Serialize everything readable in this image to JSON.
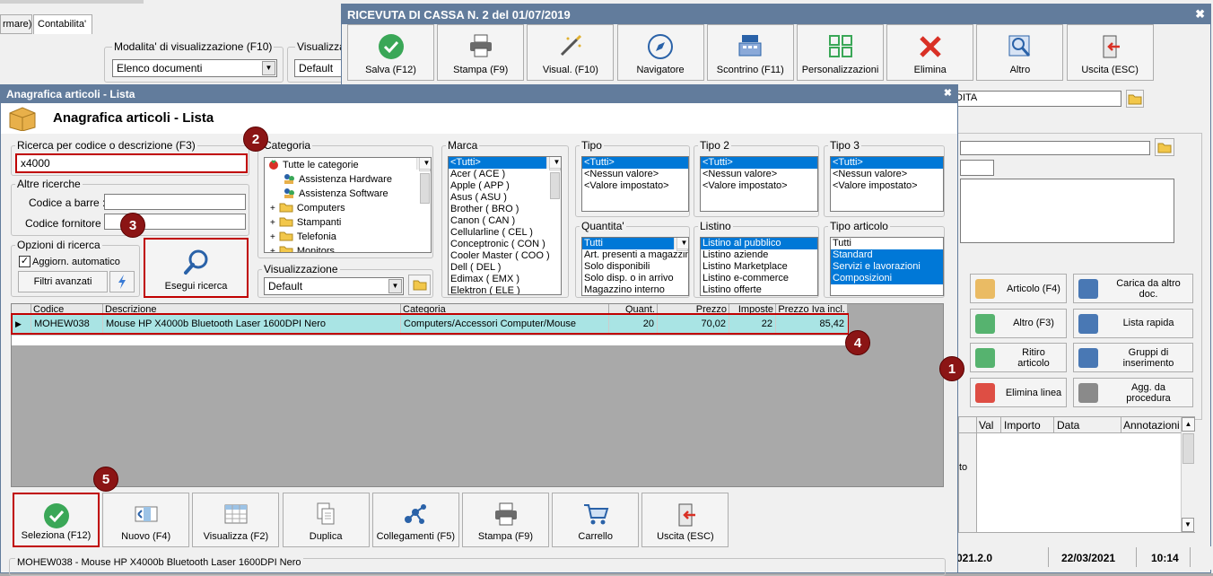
{
  "bg": {
    "tab1": "rmare)",
    "tab2": "Contabilita'",
    "mode_label": "Modalita' di visualizzazione (F10)",
    "mode_value": "Elenco documenti",
    "vis_label": "Visualizza",
    "vis_value": "Default"
  },
  "receipt": {
    "title": "RICEVUTA DI CASSA N. 2 del 01/07/2019",
    "toolbar": [
      "Salva (F12)",
      "Stampa (F9)",
      "Visual. (F10)",
      "Navigatore",
      "Scontrino (F11)",
      "Personalizzazioni",
      "Elimina",
      "Altro",
      "Uscita (ESC)"
    ],
    "field_text": "DITA",
    "side_buttons": [
      [
        "Articolo (F4)",
        "Carica da altro doc."
      ],
      [
        "Altro (F3)",
        "Lista rapida"
      ],
      [
        "Ritiro articolo",
        "Gruppi di inserimento"
      ],
      [
        "Elimina linea",
        "Agg. da procedura"
      ]
    ],
    "grid_headers": [
      "Val",
      "Importo",
      "Data",
      "Annotazioni"
    ],
    "grid_fragment": "to",
    "status": [
      "021.2.0",
      "22/03/2021",
      "10:14"
    ]
  },
  "dialog": {
    "titlebar": "Anagrafica articoli  - Lista",
    "heading": "Anagrafica articoli  - Lista",
    "search_label": "Ricerca per codice o descrizione (F3)",
    "search_value": "x4000",
    "other_label": "Altre ricerche",
    "barcode_label": "Codice a barre :",
    "supplier_label": "Codice fornitore :",
    "options_label": "Opzioni di ricerca",
    "auto_update": "Aggiorn. automatico",
    "advanced": "Filtri avanzati",
    "run_search": "Esegui ricerca",
    "category_label": "Categoria",
    "categories": [
      "Tutte le categorie",
      "Assistenza Hardware",
      "Assistenza Software",
      "Computers",
      "Stampanti",
      "Telefonia",
      "Monitors"
    ],
    "view_label": "Visualizzazione",
    "view_value": "Default",
    "brand_label": "Marca",
    "brands": [
      "<Tutti>",
      "Acer ( ACE )",
      "Apple ( APP )",
      "Asus ( ASU )",
      "Brother ( BRO )",
      "Canon ( CAN )",
      "Cellularline ( CEL )",
      "Conceptronic ( CON )",
      "Cooler Master ( COO )",
      "Dell ( DEL )",
      "Edimax ( EMX )",
      "Elektron ( ELE )"
    ],
    "tipo_label": "Tipo",
    "tipo2_label": "Tipo 2",
    "tipo3_label": "Tipo 3",
    "tipo_items": [
      "<Tutti>",
      "<Nessun valore>",
      "<Valore impostato>"
    ],
    "qty_label": "Quantita'",
    "qty_items": [
      "Tutti",
      "Art. presenti a magazzino",
      "Solo disponibili",
      "Solo disp. o in arrivo",
      "Magazzino interno"
    ],
    "listino_label": "Listino",
    "listino_items": [
      "Listino al pubblico",
      "Listino aziende",
      "Listino Marketplace",
      "Listino e-commerce",
      "Listino offerte"
    ],
    "tipoart_label": "Tipo articolo",
    "tipoart_items": [
      "Tutti",
      "Standard",
      "Servizi e lavorazioni",
      "Composizioni"
    ],
    "columns": [
      "Codice",
      "Descrizione",
      "Categoria",
      "Quant.",
      "Prezzo",
      "Imposte",
      "Prezzo Iva incl."
    ],
    "rows": [
      {
        "code": "MOHEW038",
        "desc": "Mouse HP X4000b Bluetooth Laser 1600DPI Nero",
        "cat": "Computers/Accessori Computer/Mouse",
        "qty": "20",
        "price": "70,02",
        "tax": "22",
        "gross": "85,42"
      }
    ],
    "buttons": [
      "Seleziona (F12)",
      "Nuovo (F4)",
      "Visualizza (F2)",
      "Duplica",
      "Collegamenti (F5)",
      "Stampa (F9)",
      "Carrello",
      "Uscita (ESC)"
    ],
    "footer": "MOHEW038 - Mouse HP X4000b Bluetooth Laser 1600DPI Nero"
  },
  "badges": [
    "1",
    "2",
    "3",
    "4",
    "5"
  ],
  "colors": {
    "title": "#627c9c",
    "accent": "#0078d7",
    "highlight": "#c00000",
    "row": "#a9e4e4",
    "badge": "#8b1515"
  }
}
